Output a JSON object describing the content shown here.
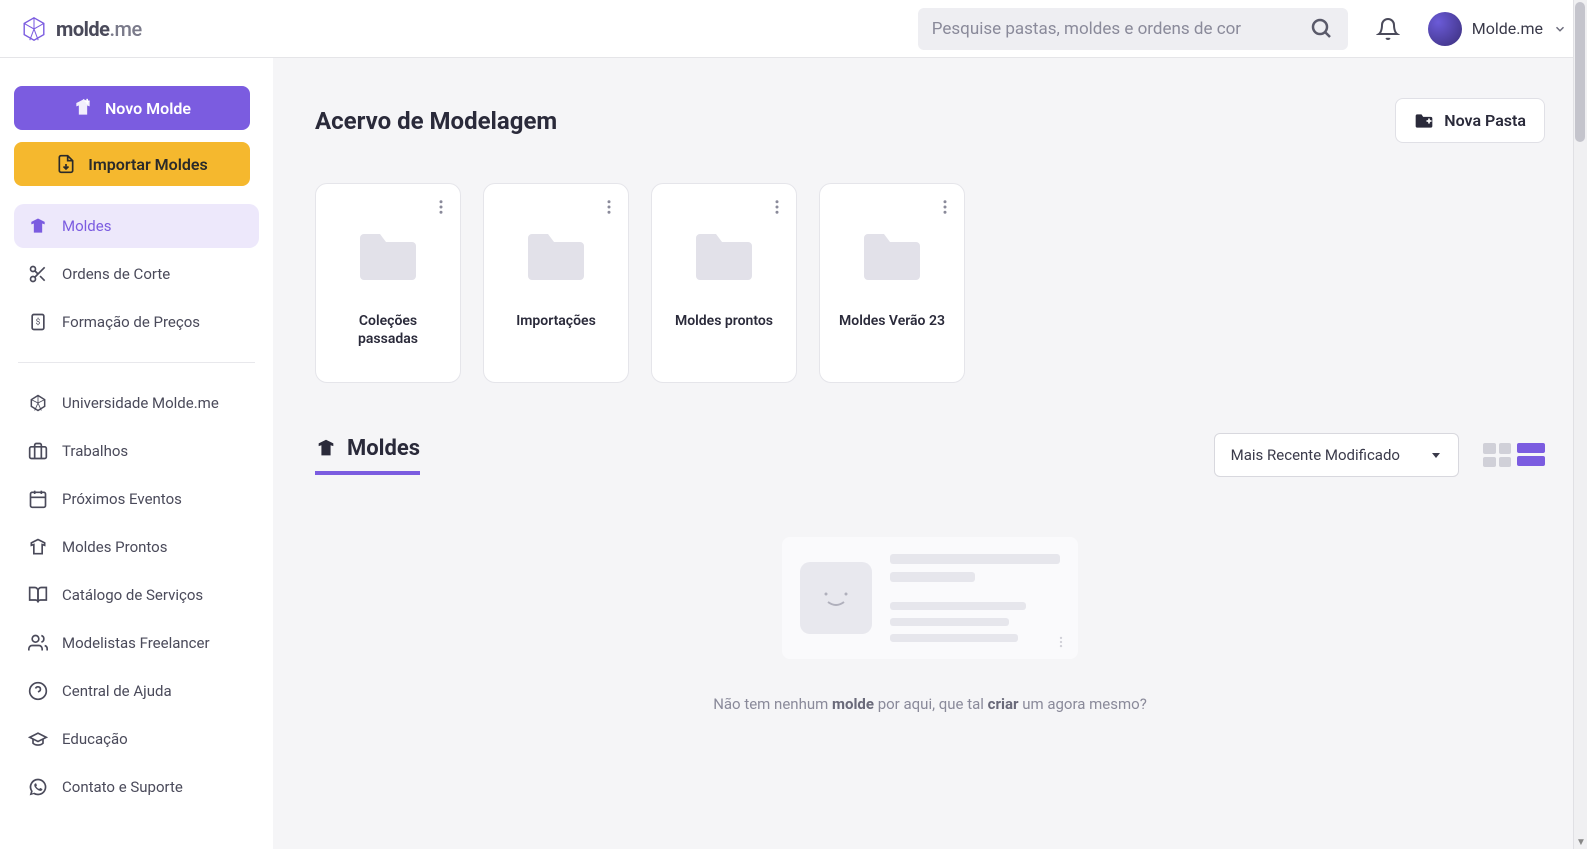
{
  "header": {
    "logo_bold": "molde",
    "logo_light": ".me",
    "search_placeholder": "Pesquise pastas, moldes e ordens de cor",
    "user_name": "Molde.me"
  },
  "sidebar": {
    "primary_btn": "Novo Molde",
    "secondary_btn": "Importar Moldes",
    "nav_main": [
      {
        "label": "Moldes",
        "icon": "shirt",
        "active": true
      },
      {
        "label": "Ordens de Corte",
        "icon": "scissors",
        "active": false
      },
      {
        "label": "Formação de Preços",
        "icon": "price-tag",
        "active": false
      }
    ],
    "nav_secondary": [
      {
        "label": "Universidade Molde.me",
        "icon": "hexagon"
      },
      {
        "label": "Trabalhos",
        "icon": "briefcase"
      },
      {
        "label": "Próximos Eventos",
        "icon": "calendar"
      },
      {
        "label": "Moldes Prontos",
        "icon": "shirt-outline"
      },
      {
        "label": "Catálogo de Serviços",
        "icon": "book"
      },
      {
        "label": "Modelistas Freelancer",
        "icon": "users"
      },
      {
        "label": "Central de Ajuda",
        "icon": "help"
      },
      {
        "label": "Educação",
        "icon": "grad-cap"
      },
      {
        "label": "Contato e Suporte",
        "icon": "whatsapp"
      }
    ]
  },
  "main": {
    "page_title": "Acervo de Modelagem",
    "new_folder_btn": "Nova Pasta",
    "folders": [
      {
        "name": "Coleções passadas"
      },
      {
        "name": "Importações"
      },
      {
        "name": "Moldes prontos"
      },
      {
        "name": "Moldes Verão 23"
      }
    ],
    "section_tab": "Moldes",
    "sort_value": "Mais Recente Modificado",
    "empty_text_1": "Não tem nenhum ",
    "empty_text_2": "molde",
    "empty_text_3": " por aqui, que tal ",
    "empty_text_4": "criar",
    "empty_text_5": " um agora mesmo?"
  }
}
